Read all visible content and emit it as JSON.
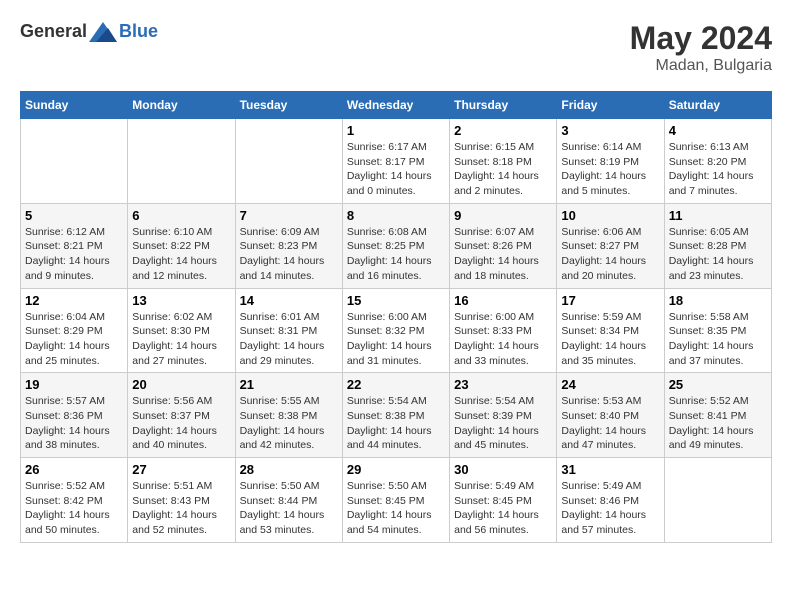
{
  "header": {
    "logo_general": "General",
    "logo_blue": "Blue",
    "month_year": "May 2024",
    "location": "Madan, Bulgaria"
  },
  "days_of_week": [
    "Sunday",
    "Monday",
    "Tuesday",
    "Wednesday",
    "Thursday",
    "Friday",
    "Saturday"
  ],
  "weeks": [
    [
      {
        "day": "",
        "sunrise": "",
        "sunset": "",
        "daylight": ""
      },
      {
        "day": "",
        "sunrise": "",
        "sunset": "",
        "daylight": ""
      },
      {
        "day": "",
        "sunrise": "",
        "sunset": "",
        "daylight": ""
      },
      {
        "day": "1",
        "sunrise": "Sunrise: 6:17 AM",
        "sunset": "Sunset: 8:17 PM",
        "daylight": "Daylight: 14 hours and 0 minutes."
      },
      {
        "day": "2",
        "sunrise": "Sunrise: 6:15 AM",
        "sunset": "Sunset: 8:18 PM",
        "daylight": "Daylight: 14 hours and 2 minutes."
      },
      {
        "day": "3",
        "sunrise": "Sunrise: 6:14 AM",
        "sunset": "Sunset: 8:19 PM",
        "daylight": "Daylight: 14 hours and 5 minutes."
      },
      {
        "day": "4",
        "sunrise": "Sunrise: 6:13 AM",
        "sunset": "Sunset: 8:20 PM",
        "daylight": "Daylight: 14 hours and 7 minutes."
      }
    ],
    [
      {
        "day": "5",
        "sunrise": "Sunrise: 6:12 AM",
        "sunset": "Sunset: 8:21 PM",
        "daylight": "Daylight: 14 hours and 9 minutes."
      },
      {
        "day": "6",
        "sunrise": "Sunrise: 6:10 AM",
        "sunset": "Sunset: 8:22 PM",
        "daylight": "Daylight: 14 hours and 12 minutes."
      },
      {
        "day": "7",
        "sunrise": "Sunrise: 6:09 AM",
        "sunset": "Sunset: 8:23 PM",
        "daylight": "Daylight: 14 hours and 14 minutes."
      },
      {
        "day": "8",
        "sunrise": "Sunrise: 6:08 AM",
        "sunset": "Sunset: 8:25 PM",
        "daylight": "Daylight: 14 hours and 16 minutes."
      },
      {
        "day": "9",
        "sunrise": "Sunrise: 6:07 AM",
        "sunset": "Sunset: 8:26 PM",
        "daylight": "Daylight: 14 hours and 18 minutes."
      },
      {
        "day": "10",
        "sunrise": "Sunrise: 6:06 AM",
        "sunset": "Sunset: 8:27 PM",
        "daylight": "Daylight: 14 hours and 20 minutes."
      },
      {
        "day": "11",
        "sunrise": "Sunrise: 6:05 AM",
        "sunset": "Sunset: 8:28 PM",
        "daylight": "Daylight: 14 hours and 23 minutes."
      }
    ],
    [
      {
        "day": "12",
        "sunrise": "Sunrise: 6:04 AM",
        "sunset": "Sunset: 8:29 PM",
        "daylight": "Daylight: 14 hours and 25 minutes."
      },
      {
        "day": "13",
        "sunrise": "Sunrise: 6:02 AM",
        "sunset": "Sunset: 8:30 PM",
        "daylight": "Daylight: 14 hours and 27 minutes."
      },
      {
        "day": "14",
        "sunrise": "Sunrise: 6:01 AM",
        "sunset": "Sunset: 8:31 PM",
        "daylight": "Daylight: 14 hours and 29 minutes."
      },
      {
        "day": "15",
        "sunrise": "Sunrise: 6:00 AM",
        "sunset": "Sunset: 8:32 PM",
        "daylight": "Daylight: 14 hours and 31 minutes."
      },
      {
        "day": "16",
        "sunrise": "Sunrise: 6:00 AM",
        "sunset": "Sunset: 8:33 PM",
        "daylight": "Daylight: 14 hours and 33 minutes."
      },
      {
        "day": "17",
        "sunrise": "Sunrise: 5:59 AM",
        "sunset": "Sunset: 8:34 PM",
        "daylight": "Daylight: 14 hours and 35 minutes."
      },
      {
        "day": "18",
        "sunrise": "Sunrise: 5:58 AM",
        "sunset": "Sunset: 8:35 PM",
        "daylight": "Daylight: 14 hours and 37 minutes."
      }
    ],
    [
      {
        "day": "19",
        "sunrise": "Sunrise: 5:57 AM",
        "sunset": "Sunset: 8:36 PM",
        "daylight": "Daylight: 14 hours and 38 minutes."
      },
      {
        "day": "20",
        "sunrise": "Sunrise: 5:56 AM",
        "sunset": "Sunset: 8:37 PM",
        "daylight": "Daylight: 14 hours and 40 minutes."
      },
      {
        "day": "21",
        "sunrise": "Sunrise: 5:55 AM",
        "sunset": "Sunset: 8:38 PM",
        "daylight": "Daylight: 14 hours and 42 minutes."
      },
      {
        "day": "22",
        "sunrise": "Sunrise: 5:54 AM",
        "sunset": "Sunset: 8:38 PM",
        "daylight": "Daylight: 14 hours and 44 minutes."
      },
      {
        "day": "23",
        "sunrise": "Sunrise: 5:54 AM",
        "sunset": "Sunset: 8:39 PM",
        "daylight": "Daylight: 14 hours and 45 minutes."
      },
      {
        "day": "24",
        "sunrise": "Sunrise: 5:53 AM",
        "sunset": "Sunset: 8:40 PM",
        "daylight": "Daylight: 14 hours and 47 minutes."
      },
      {
        "day": "25",
        "sunrise": "Sunrise: 5:52 AM",
        "sunset": "Sunset: 8:41 PM",
        "daylight": "Daylight: 14 hours and 49 minutes."
      }
    ],
    [
      {
        "day": "26",
        "sunrise": "Sunrise: 5:52 AM",
        "sunset": "Sunset: 8:42 PM",
        "daylight": "Daylight: 14 hours and 50 minutes."
      },
      {
        "day": "27",
        "sunrise": "Sunrise: 5:51 AM",
        "sunset": "Sunset: 8:43 PM",
        "daylight": "Daylight: 14 hours and 52 minutes."
      },
      {
        "day": "28",
        "sunrise": "Sunrise: 5:50 AM",
        "sunset": "Sunset: 8:44 PM",
        "daylight": "Daylight: 14 hours and 53 minutes."
      },
      {
        "day": "29",
        "sunrise": "Sunrise: 5:50 AM",
        "sunset": "Sunset: 8:45 PM",
        "daylight": "Daylight: 14 hours and 54 minutes."
      },
      {
        "day": "30",
        "sunrise": "Sunrise: 5:49 AM",
        "sunset": "Sunset: 8:45 PM",
        "daylight": "Daylight: 14 hours and 56 minutes."
      },
      {
        "day": "31",
        "sunrise": "Sunrise: 5:49 AM",
        "sunset": "Sunset: 8:46 PM",
        "daylight": "Daylight: 14 hours and 57 minutes."
      },
      {
        "day": "",
        "sunrise": "",
        "sunset": "",
        "daylight": ""
      }
    ]
  ]
}
